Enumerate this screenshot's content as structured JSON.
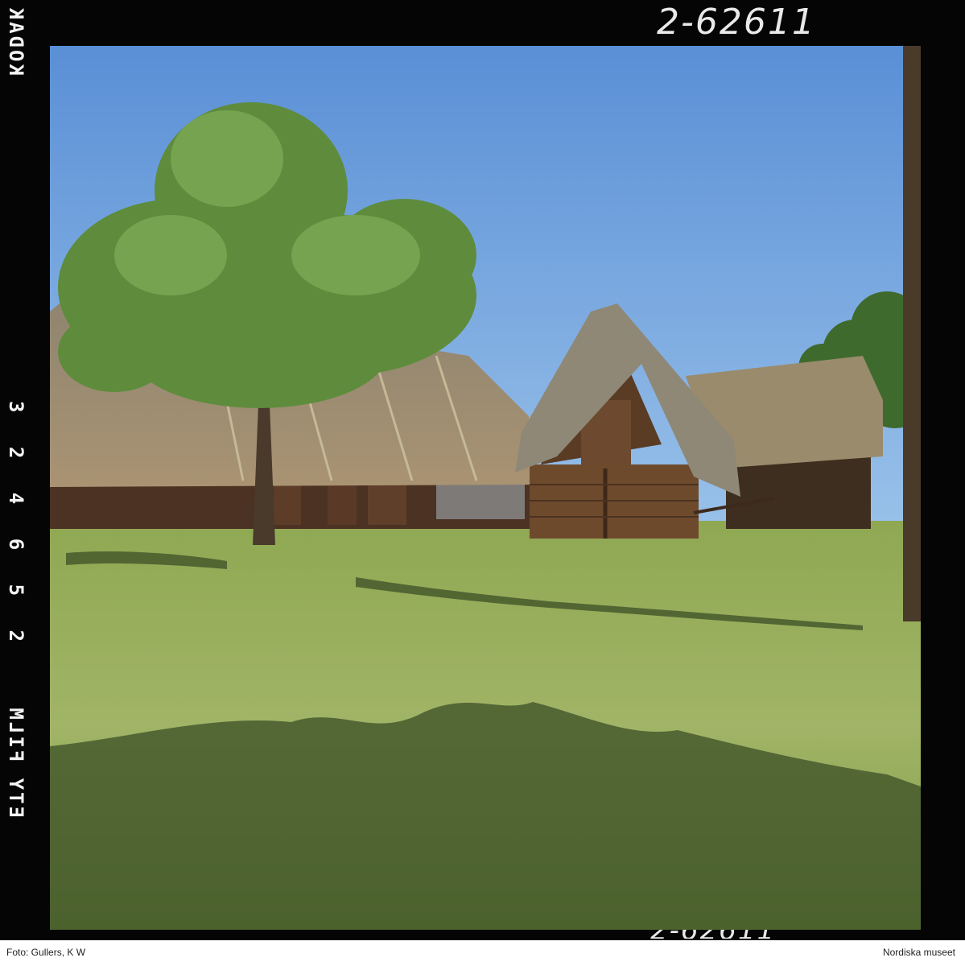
{
  "photo": {
    "frame_code": "2-62611",
    "film_edge": {
      "brand_text": "KODAK SAFETY FILM",
      "frame_numbers": "3 2 4 6 5 2",
      "bottom_text": "ETY FILM"
    },
    "colors": {
      "sky": "#6a9bd9",
      "grass": "#95ac5a",
      "thatch": "#9c8a66",
      "wood": "#5b3a24",
      "foliage": "#5f8a3c"
    }
  },
  "caption": {
    "credit": "Foto: Gullers, K W",
    "institution": "Nordiska museet"
  }
}
